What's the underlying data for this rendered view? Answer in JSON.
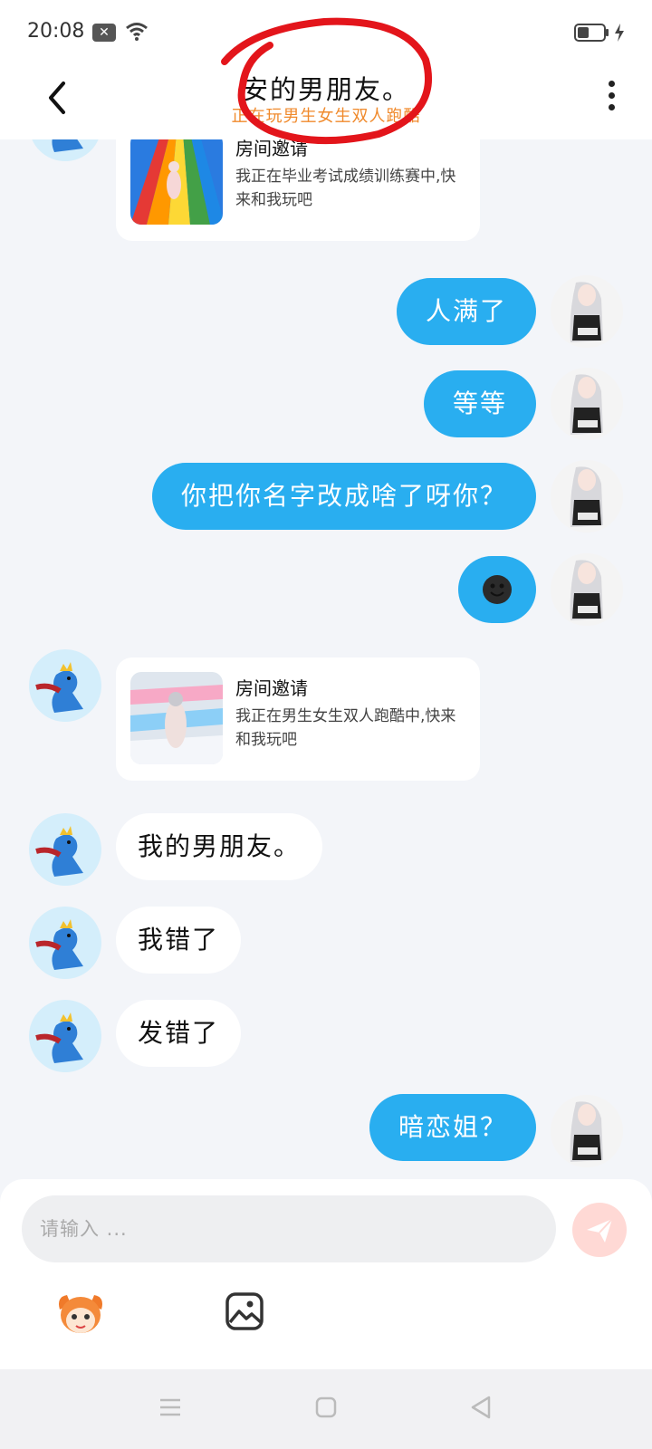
{
  "status_bar": {
    "time": "20:08",
    "icons": [
      "notification-x-icon",
      "wifi-icon",
      "battery-icon",
      "charging-icon"
    ]
  },
  "header": {
    "title": "安的男朋友。",
    "subtitle": "正在玩男生女生双人跑酷",
    "icons": [
      "back-arrow-icon",
      "more-vertical-icon"
    ]
  },
  "annotation": {
    "color": "#e3151b",
    "shape": "hand-drawn-circle-around-title"
  },
  "messages": [
    {
      "from": "them",
      "type": "card",
      "card_title": "房间邀请",
      "card_desc": "我正在毕业考试成绩训练赛中,快来和我玩吧"
    },
    {
      "from": "me",
      "type": "text",
      "text": "人满了"
    },
    {
      "from": "me",
      "type": "text",
      "text": "等等"
    },
    {
      "from": "me",
      "type": "text",
      "text": "你把你名字改成啥了呀你？"
    },
    {
      "from": "me",
      "type": "emoji",
      "emoji": "smiling-face-emoji"
    },
    {
      "from": "them",
      "type": "card",
      "card_title": "房间邀请",
      "card_desc": "我正在男生女生双人跑酷中,快来和我玩吧"
    },
    {
      "from": "them",
      "type": "text",
      "text": "我的男朋友。"
    },
    {
      "from": "them",
      "type": "text",
      "text": "我错了"
    },
    {
      "from": "them",
      "type": "text",
      "text": "发错了"
    },
    {
      "from": "me",
      "type": "text",
      "text": "暗恋姐？"
    }
  ],
  "input": {
    "placeholder": "请输入 ..."
  },
  "toolbar_icons": [
    "send-icon",
    "mascot-icon",
    "image-icon"
  ],
  "nav_icons": [
    "menu-icon",
    "home-icon",
    "back-triangle-icon"
  ],
  "colors": {
    "my_bubble": "#29aef0",
    "their_bubble": "#ffffff",
    "subtitle": "#f08a2c",
    "background": "#f3f5f9"
  }
}
